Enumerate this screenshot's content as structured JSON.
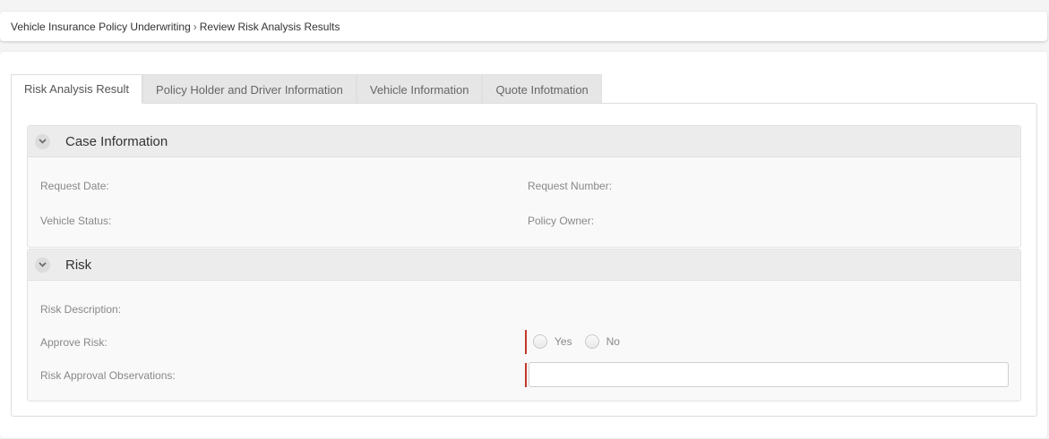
{
  "breadcrumb": {
    "root": "Vehicle Insurance Policy Underwriting",
    "separator": "›",
    "current": "Review Risk Analysis Results"
  },
  "tabs": [
    {
      "label": "Risk Analysis Result",
      "active": true
    },
    {
      "label": "Policy Holder and Driver Information",
      "active": false
    },
    {
      "label": "Vehicle Information",
      "active": false
    },
    {
      "label": "Quote Infotmation",
      "active": false
    }
  ],
  "case_information": {
    "title": "Case Information",
    "request_date_label": "Request Date:",
    "request_number_label": "Request Number:",
    "vehicle_status_label": "Vehicle Status:",
    "policy_owner_label": "Policy Owner:"
  },
  "risk": {
    "title": "Risk",
    "risk_description_label": "Risk Description:",
    "approve_risk_label": "Approve Risk:",
    "approve_yes_label": "Yes",
    "approve_no_label": "No",
    "observations_label": "Risk Approval Observations:",
    "observations_value": ""
  },
  "colors": {
    "required_marker": "#c0392b",
    "section_header_bg": "#ececec",
    "tab_inactive_bg": "#e6e6e6"
  },
  "icons": {
    "section_toggle": "chevron-down-icon"
  }
}
